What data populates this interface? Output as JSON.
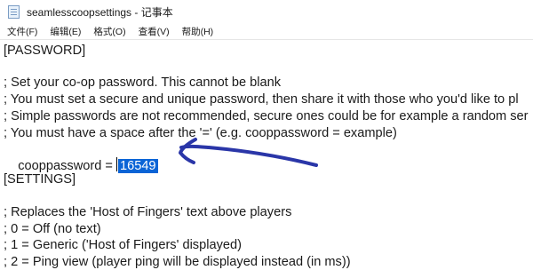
{
  "window": {
    "title": "seamlesscoopsettings - 记事本",
    "app_icon": "notepad-icon"
  },
  "menu": {
    "items": [
      "文件(F)",
      "编辑(E)",
      "格式(O)",
      "查看(V)",
      "帮助(H)"
    ]
  },
  "editor": {
    "lines": [
      "[PASSWORD]",
      "",
      "; Set your co-op password. This cannot be blank",
      "; You must set a secure and unique password, then share it with those who you'd like to pl",
      "; Simple passwords are not recommended, secure ones could be for example a random ser",
      "; You must have a space after the '=' (e.g. cooppassword = example)",
      "cooppassword = ",
      "",
      "[SETTINGS]",
      "",
      "; Replaces the 'Host of Fingers' text above players",
      "; 0 = Off (no text)",
      "; 1 = Generic ('Host of Fingers' displayed)",
      "; 2 = Ping view (player ping will be displayed instead (in ms))"
    ],
    "selected_value": "16549",
    "selection_color": "#0a64d6"
  },
  "annotation": {
    "arrow_color": "#2a36a8",
    "arrow_icon": "hand-drawn-arrow"
  }
}
